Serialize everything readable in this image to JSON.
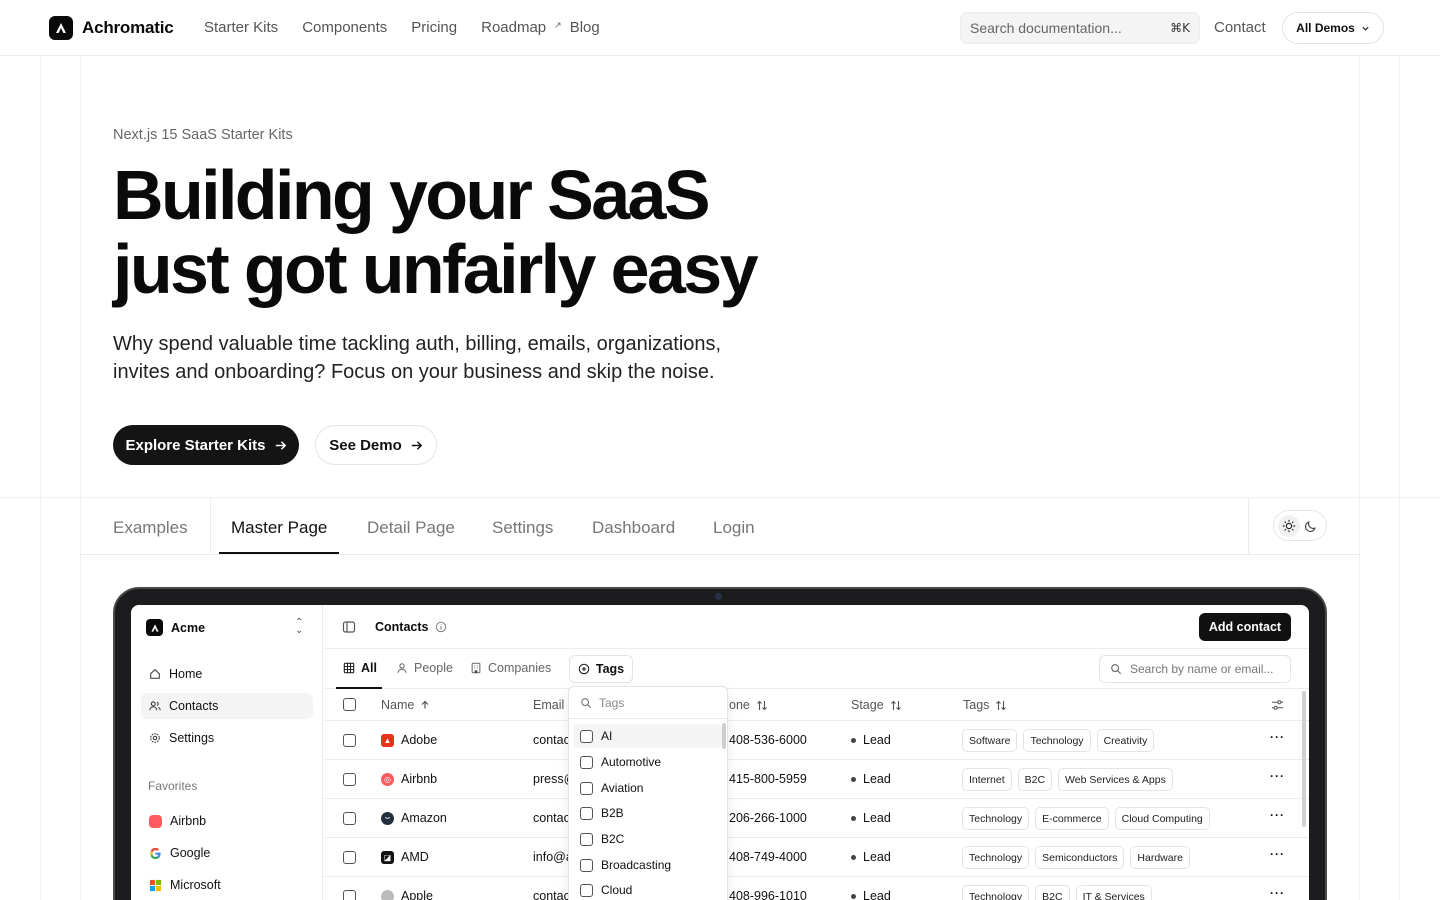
{
  "nav": {
    "brand": "Achromatic",
    "links": [
      "Starter Kits",
      "Components",
      "Pricing",
      "Roadmap",
      "Blog"
    ],
    "search_placeholder": "Search documentation...",
    "search_shortcut": "⌘K",
    "contact": "Contact",
    "all_demos": "All Demos"
  },
  "hero": {
    "kicker": "Next.js 15 SaaS Starter Kits",
    "title_line1": "Building your SaaS",
    "title_line2": "just got unfairly easy",
    "subtitle": "Why spend valuable time tackling auth, billing, emails, organizations, invites and onboarding? Focus on your business and skip the noise.",
    "primary_cta": "Explore Starter Kits",
    "secondary_cta": "See Demo"
  },
  "demo_tabs": [
    "Examples",
    "Master Page",
    "Detail Page",
    "Settings",
    "Dashboard",
    "Login"
  ],
  "active_demo_tab": "Master Page",
  "app": {
    "workspace": "Acme",
    "nav": [
      "Home",
      "Contacts",
      "Settings"
    ],
    "active_nav": "Contacts",
    "favorites_label": "Favorites",
    "favorites": [
      "Airbnb",
      "Google",
      "Microsoft"
    ],
    "page_title": "Contacts",
    "add_button": "Add contact",
    "filters": [
      "All",
      "People",
      "Companies"
    ],
    "tags_button": "Tags",
    "search_placeholder": "Search by name or email...",
    "columns": [
      "Name",
      "Email",
      "one",
      "Stage",
      "Tags"
    ],
    "rows": [
      {
        "name": "Adobe",
        "email": "contac",
        "phone": "408-536-6000",
        "stage": "Lead",
        "tags": [
          "Software",
          "Technology",
          "Creativity"
        ]
      },
      {
        "name": "Airbnb",
        "email": "press@",
        "phone": "415-800-5959",
        "stage": "Lead",
        "tags": [
          "Internet",
          "B2C",
          "Web Services & Apps"
        ]
      },
      {
        "name": "Amazon",
        "email": "contac",
        "phone": "206-266-1000",
        "stage": "Lead",
        "tags": [
          "Technology",
          "E-commerce",
          "Cloud Computing"
        ]
      },
      {
        "name": "AMD",
        "email": "info@a",
        "phone": "408-749-4000",
        "stage": "Lead",
        "tags": [
          "Technology",
          "Semiconductors",
          "Hardware"
        ]
      },
      {
        "name": "Apple",
        "email": "contac",
        "phone": "408-996-1010",
        "stage": "Lead",
        "tags": [
          "Technology",
          "B2C",
          "IT & Services"
        ]
      }
    ],
    "tag_popover": {
      "placeholder": "Tags",
      "options": [
        "AI",
        "Automotive",
        "Aviation",
        "B2B",
        "B2C",
        "Broadcasting",
        "Cloud"
      ]
    }
  },
  "colors": {
    "primary": "#141414",
    "border": "#e4e4e7",
    "muted_text": "#666666",
    "adobe": "#e8331c",
    "airbnb": "#ff5a5f"
  }
}
